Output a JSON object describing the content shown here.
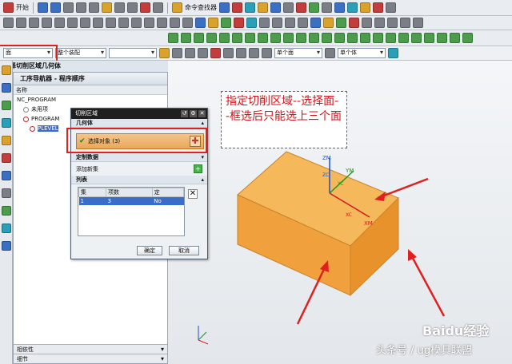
{
  "toolbar": {
    "start_label": "开始",
    "command_finder_label": "命令查找器",
    "filter_value": "面",
    "type_filter_value": "整个装配",
    "scope1_value": "单个面",
    "scope2_value": "单个体"
  },
  "filter_header": "选择切削区域几何体",
  "navigator": {
    "title": "工序导航器 - 程序顺序",
    "column_name": "名称",
    "rows": [
      "NC_PROGRAM",
      "未用项",
      "PROGRAM",
      "PLEVEL"
    ],
    "bottom1": "相依性",
    "bottom2": "细节"
  },
  "dialog": {
    "title": "切削区域",
    "geometry_section": "几何体",
    "select_object_label": "选择对象 (3)",
    "custom_data_label": "定制数据",
    "add_set_label": "添加新集",
    "list_label": "列表",
    "table_headers": [
      "集",
      "项数",
      "定"
    ],
    "table_rows": [
      [
        "1",
        "3",
        "No"
      ]
    ],
    "ok_label": "确定",
    "cancel_label": "取消"
  },
  "annotation": {
    "text": "指定切削区域--选择面--框选后只能选上三个面"
  },
  "axes": {
    "zm": "ZM",
    "ym": "YM",
    "xm": "XM",
    "zc": "ZC",
    "yc": "YC",
    "xc": "XC"
  },
  "watermark": {
    "brand": "Baidu经验",
    "author": "头条号 / ug模具联盟"
  },
  "colors": {
    "highlight_red": "#e01f1f",
    "solid_orange": "#f2a94a",
    "annotation_red": "#d3131b"
  }
}
